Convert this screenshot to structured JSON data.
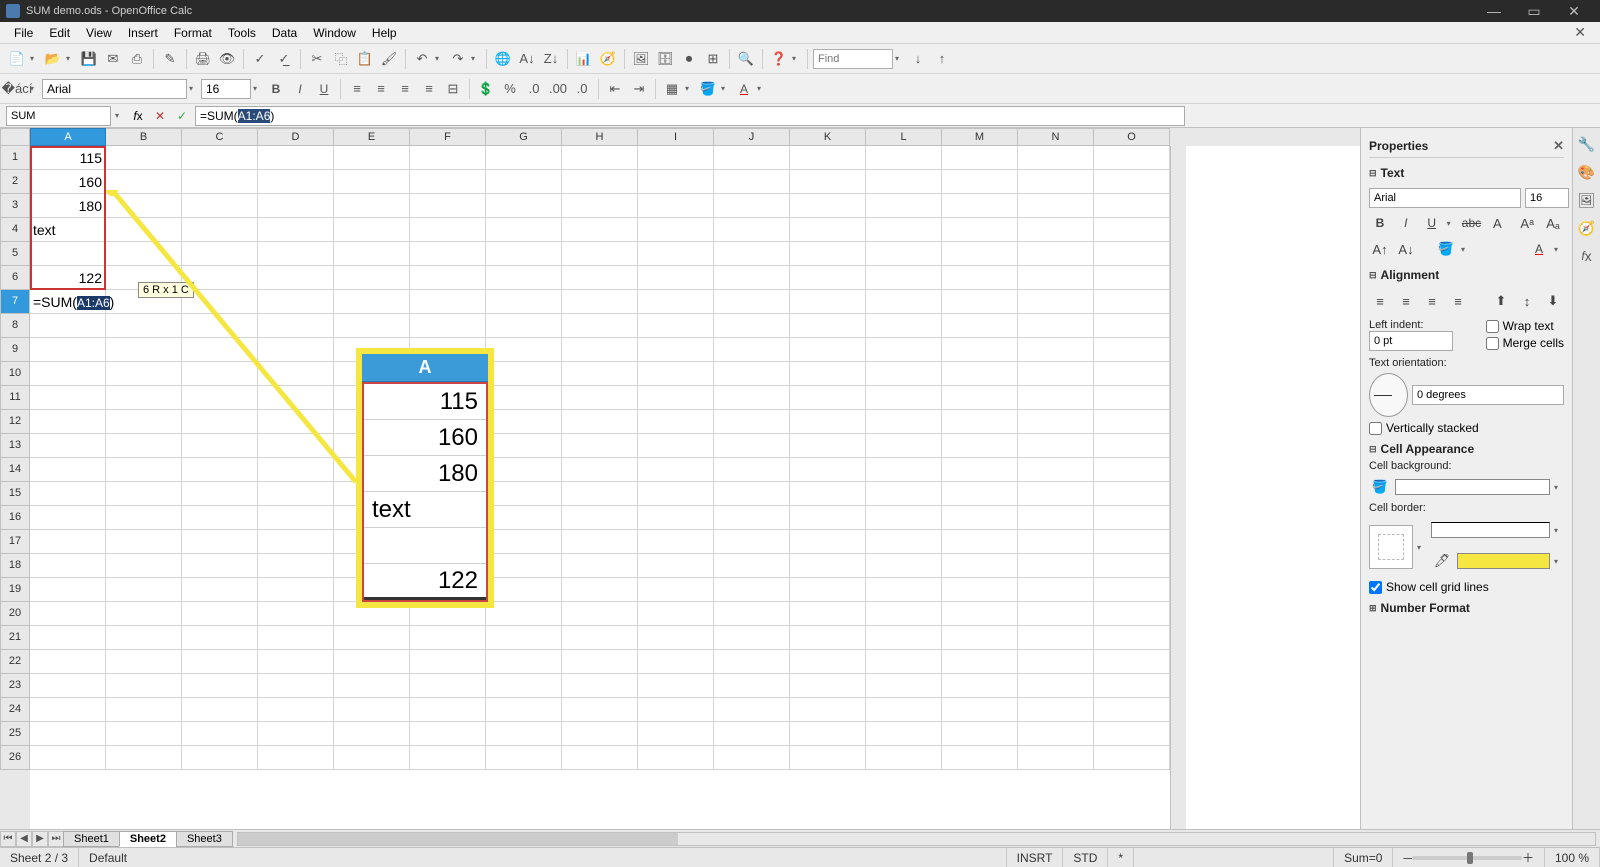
{
  "title": "SUM demo.ods - OpenOffice Calc",
  "menu": [
    "File",
    "Edit",
    "View",
    "Insert",
    "Format",
    "Tools",
    "Data",
    "Window",
    "Help"
  ],
  "find_placeholder": "Find",
  "font": {
    "name": "Arial",
    "size": "16"
  },
  "namebox": "SUM",
  "formula_prefix": "=SUM(",
  "formula_sel": "A1:A6",
  "formula_suffix": ")",
  "columns": [
    "A",
    "B",
    "C",
    "D",
    "E",
    "F",
    "G",
    "H",
    "I",
    "J",
    "K",
    "L",
    "M",
    "N",
    "O"
  ],
  "row_count": 26,
  "cells": {
    "A1": "115",
    "A2": "160",
    "A3": "180",
    "A4": "text",
    "A5": "",
    "A6": "122"
  },
  "celledit_prefix": "=SUM(",
  "celledit_sel": "A1:A6",
  "celledit_suffix": ")",
  "range_tip": "6 R x 1 C",
  "callout": {
    "header": "A",
    "rows": [
      "115",
      "160",
      "180",
      "text",
      "",
      "122"
    ]
  },
  "sidebar": {
    "title": "Properties",
    "text_section": "Text",
    "font_name": "Arial",
    "font_size": "16",
    "alignment_section": "Alignment",
    "left_indent_label": "Left indent:",
    "left_indent_val": "0 pt",
    "wrap_text": "Wrap text",
    "merge_cells": "Merge cells",
    "orientation_label": "Text orientation:",
    "orientation_val": "0 degrees",
    "vertically_stacked": "Vertically stacked",
    "cellapp_section": "Cell Appearance",
    "cellbg_label": "Cell background:",
    "cellborder_label": "Cell border:",
    "show_grid": "Show cell grid lines",
    "numfmt_section": "Number Format"
  },
  "sheets": [
    "Sheet1",
    "Sheet2",
    "Sheet3"
  ],
  "active_sheet": 1,
  "status": {
    "sheet": "Sheet 2 / 3",
    "style": "Default",
    "mode": "INSRT",
    "sel": "STD",
    "star": "*",
    "sum": "Sum=0",
    "zoom": "100 %"
  }
}
